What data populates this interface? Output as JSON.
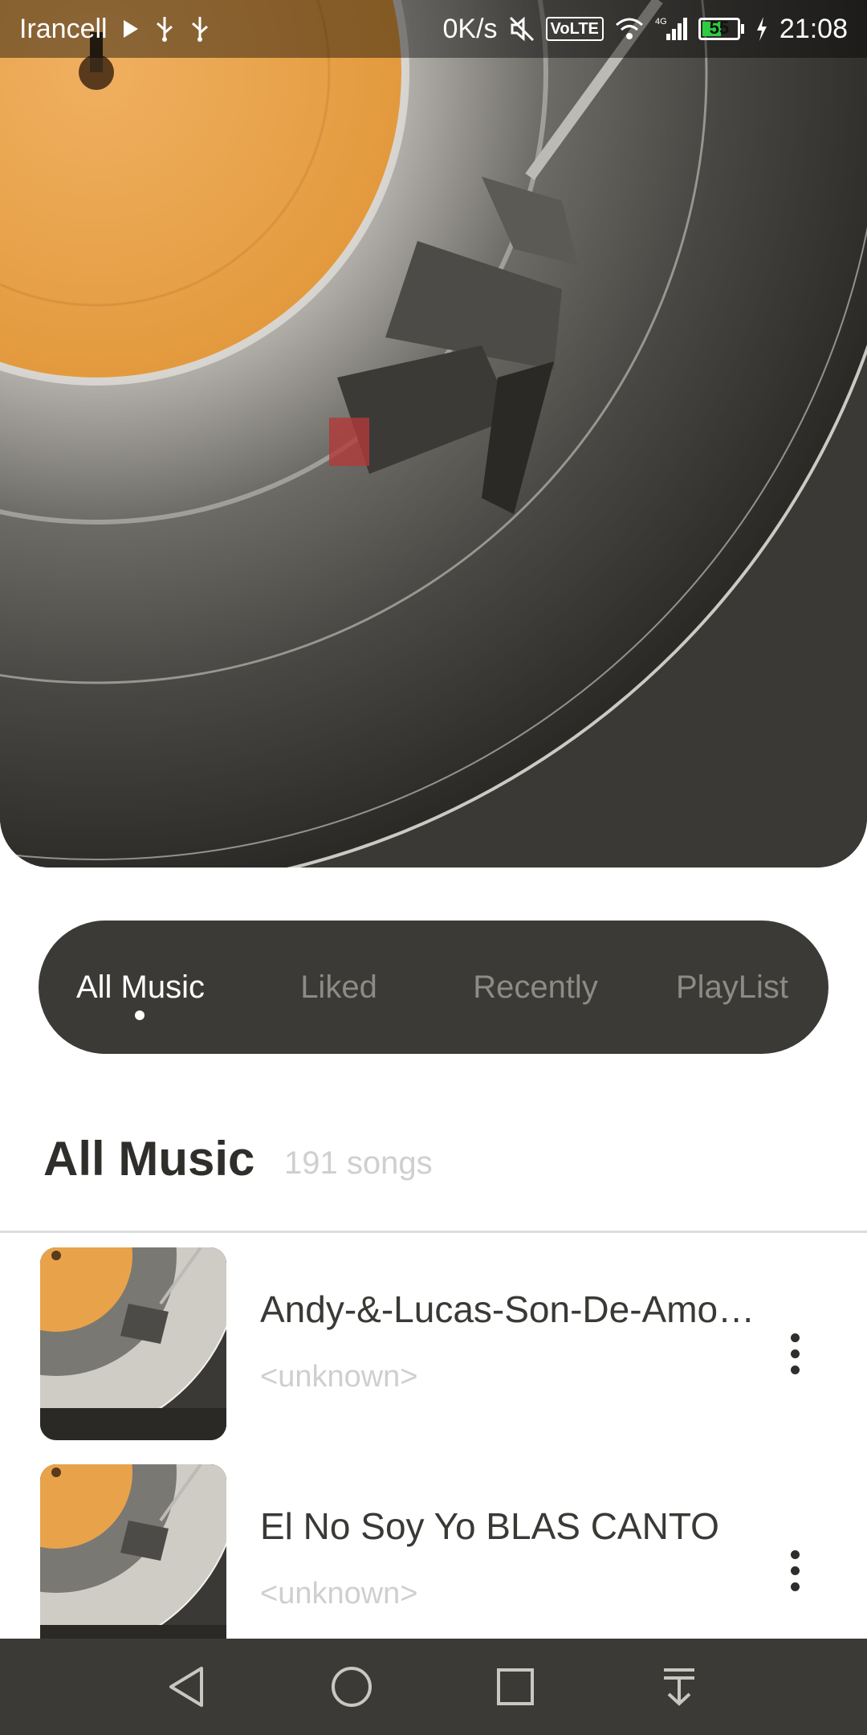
{
  "status_bar": {
    "carrier": "Irancell",
    "speed": "0K/s",
    "volte": "VoLTE",
    "network": "4G",
    "battery": "55",
    "battery_level_percent": 55,
    "time": "21:08",
    "icons": [
      "play-icon",
      "usb-icon",
      "usb-icon",
      "mute-icon",
      "wifi-icon",
      "signal-icon",
      "battery-icon",
      "charging-icon"
    ]
  },
  "tabs": [
    {
      "label": "All Music",
      "active": true
    },
    {
      "label": "Liked",
      "active": false
    },
    {
      "label": "Recently",
      "active": false
    },
    {
      "label": "PlayList",
      "active": false
    }
  ],
  "section": {
    "title": "All Music",
    "count": "191 songs"
  },
  "songs": [
    {
      "title": "Andy-&-Lucas-Son-De-Amor...",
      "artist": "<unknown>"
    },
    {
      "title": "El No Soy Yo   BLAS CANTO",
      "artist": "<unknown>"
    }
  ],
  "navbar": {
    "icons": [
      "back-icon",
      "home-icon",
      "recents-icon",
      "notification-pull-icon"
    ]
  },
  "colors": {
    "tab_bar": "#3b3a36",
    "record_label": "#e8a34a",
    "accent_text": "#2f2e2b"
  }
}
